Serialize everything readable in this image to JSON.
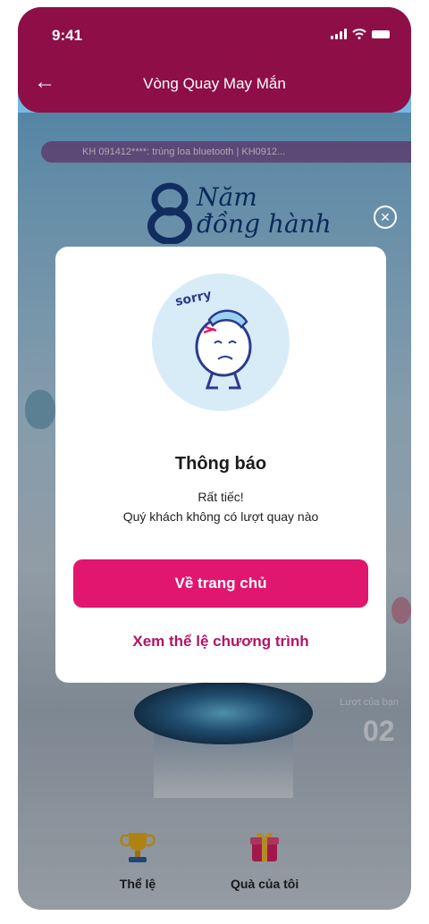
{
  "status": {
    "time": "9:41"
  },
  "header": {
    "title": "Vòng Quay May Mắn"
  },
  "ticker": {
    "text": "KH 091412****: trúng loa bluetooth  |  KH0912..."
  },
  "banner": {
    "script_line1": "Năm",
    "script_line2": "đồng hành"
  },
  "turns": {
    "label": "Lượt của bạn",
    "value": "02"
  },
  "nav": {
    "items": [
      {
        "label": "Thể lệ"
      },
      {
        "label": "Quà của tôi"
      }
    ]
  },
  "modal": {
    "sorry": "sorry",
    "title": "Thông báo",
    "line1": "Rất tiếc!",
    "line2": "Quý khách không có lượt quay nào",
    "primary_label": "Về trang chủ",
    "link_label": "Xem thể lệ chương trình"
  },
  "colors": {
    "header": "#8e0f48",
    "primary": "#e0166f",
    "link": "#b01565"
  }
}
